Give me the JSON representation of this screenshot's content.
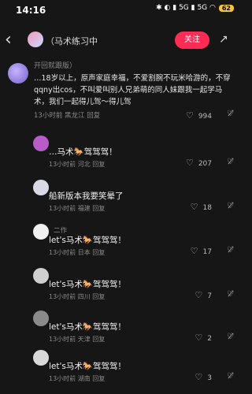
{
  "status": {
    "time": "14:16",
    "icons": "✱ ◐ ▮ 5G ▮ 5G ◠",
    "battery": "62"
  },
  "header": {
    "nickname": "（马术练习中",
    "follow_label": "关注"
  },
  "top_comment": {
    "name": "开回就跟版）",
    "body": "…18岁以上，原声家庭幸福，不爱割腕不玩米哈游的，不穿qqny出cos，不叫爱叫别人兄弟萌的同人妹跟我一起学马术，我们一起得儿驾～得儿驾",
    "meta": "13小时前 黑龙江  回复",
    "likes": "994"
  },
  "replies": [
    {
      "name": "",
      "text": "…马术🐎驾驾驾！",
      "meta": "13小时前 河北  回复",
      "likes": "207"
    },
    {
      "name": "",
      "text": "船新版本我要笑晕了",
      "meta": "13小时前 福建  回复",
      "likes": "18"
    },
    {
      "name": "二作",
      "text": "let's马术🐎驾驾驾！",
      "meta": "13小时前 日本  回复",
      "likes": "17"
    },
    {
      "name": "",
      "text": "let's马术🐎驾驾驾！",
      "meta": "13小时前 四川  回复",
      "likes": "7"
    },
    {
      "name": "",
      "text": "let's马术🐎驾驾驾！",
      "meta": "13小时前 天津  回复",
      "likes": "2"
    },
    {
      "name": "",
      "text": "let's马术🐎驾驾驾！",
      "meta": "13小时前 湖南  回复",
      "likes": "3"
    }
  ]
}
